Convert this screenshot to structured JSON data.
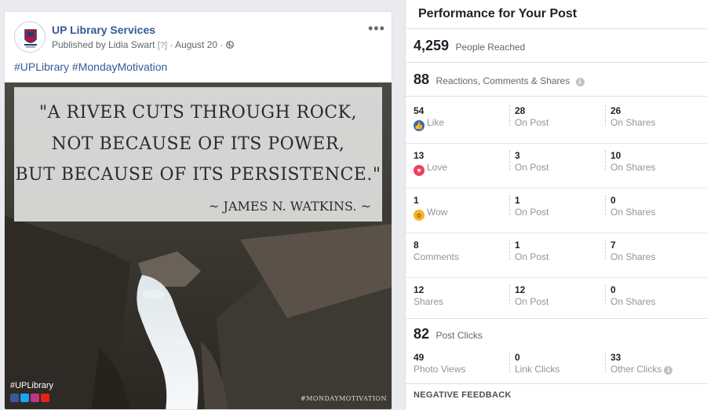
{
  "post": {
    "page_name": "UP Library Services",
    "published_prefix": "Published by",
    "author": "Lidia Swart",
    "help_marker": "[?]",
    "separator": "·",
    "date": "August 20",
    "hashtags": "#UPLibrary #MondayMotivation",
    "image": {
      "quote_lines": [
        "\"A RIVER CUTS THROUGH ROCK,",
        "NOT BECAUSE OF ITS POWER,",
        "BUT BECAUSE OF ITS PERSISTENCE.\""
      ],
      "attribution": "~ JAMES N. WATKINS. ~",
      "tag": "#UPLibrary",
      "watermark": "#MONDAYMOTIVATION"
    },
    "icons": {
      "more": "more-options-icon",
      "privacy": "globe-icon"
    }
  },
  "panel": {
    "title": "Performance for Your Post",
    "reached": {
      "value": "4,259",
      "label": "People Reached"
    },
    "engagement": {
      "value": "88",
      "label": "Reactions, Comments & Shares"
    },
    "rows": [
      {
        "total": "54",
        "label": "Like",
        "icon": "like-icon",
        "on_post": "28",
        "on_post_label": "On Post",
        "on_shares": "26",
        "on_shares_label": "On Shares"
      },
      {
        "total": "13",
        "label": "Love",
        "icon": "love-icon",
        "on_post": "3",
        "on_post_label": "On Post",
        "on_shares": "10",
        "on_shares_label": "On Shares"
      },
      {
        "total": "1",
        "label": "Wow",
        "icon": "wow-icon",
        "on_post": "1",
        "on_post_label": "On Post",
        "on_shares": "0",
        "on_shares_label": "On Shares"
      },
      {
        "total": "8",
        "label": "Comments",
        "icon": "",
        "on_post": "1",
        "on_post_label": "On Post",
        "on_shares": "7",
        "on_shares_label": "On Shares"
      },
      {
        "total": "12",
        "label": "Shares",
        "icon": "",
        "on_post": "12",
        "on_post_label": "On Post",
        "on_shares": "0",
        "on_shares_label": "On Shares"
      }
    ],
    "clicks": {
      "value": "82",
      "label": "Post Clicks",
      "photo_views": "49",
      "photo_views_label": "Photo Views",
      "link_clicks": "0",
      "link_clicks_label": "Link Clicks",
      "other_clicks": "33",
      "other_clicks_label": "Other Clicks"
    },
    "negative_feedback": "NEGATIVE FEEDBACK"
  },
  "colors": {
    "link": "#365899",
    "like": "#4267b2",
    "love": "#f33e58",
    "wow": "#f7b125"
  }
}
